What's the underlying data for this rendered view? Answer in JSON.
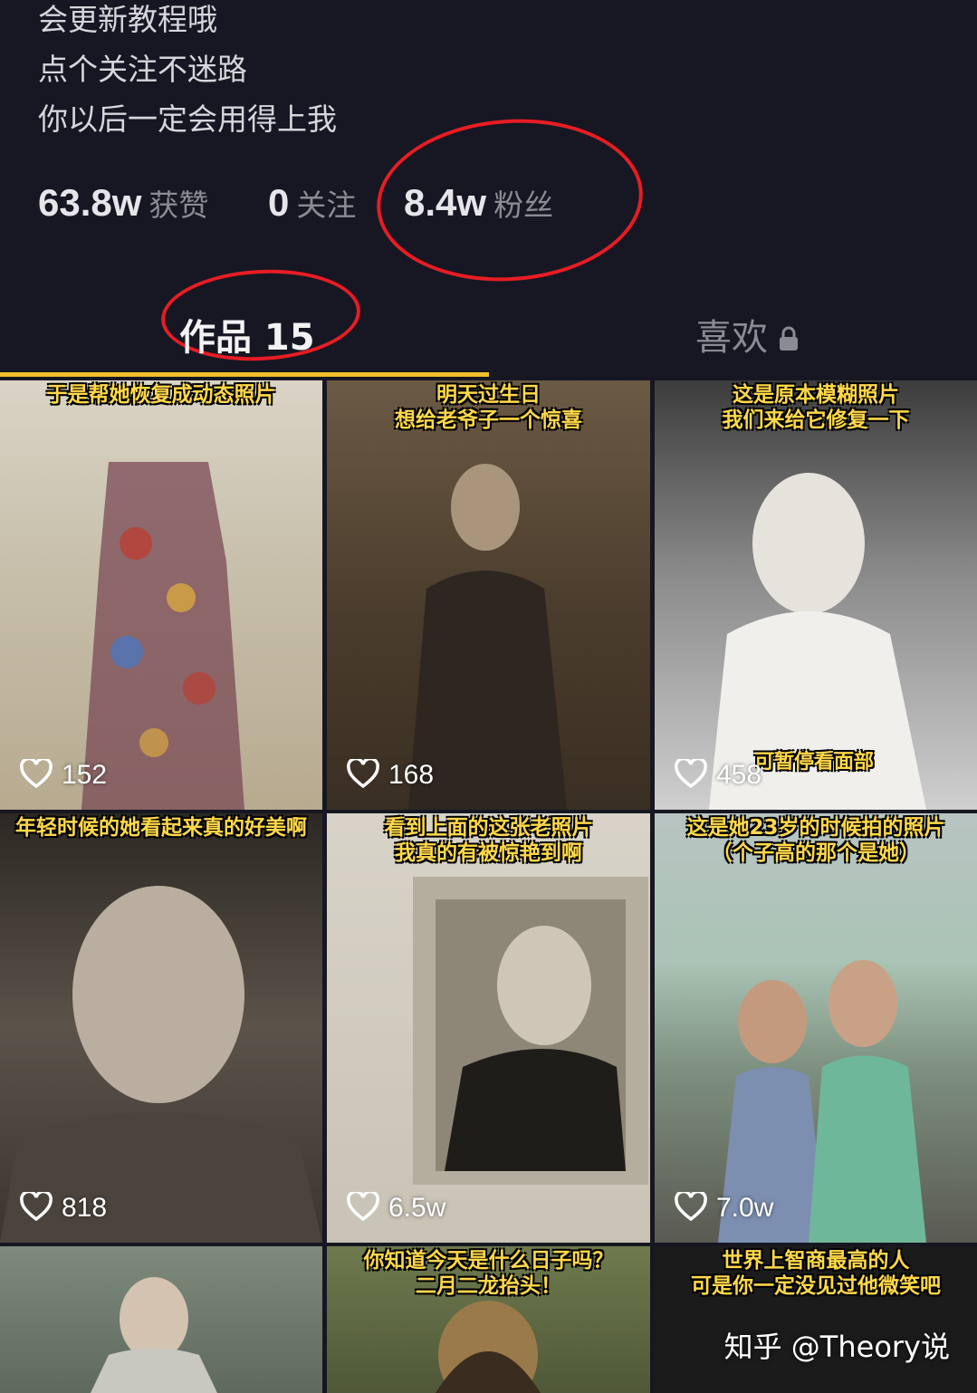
{
  "bio": {
    "lines": [
      "会更新教程哦",
      "点个关注不迷路",
      "你以后一定会用得上我"
    ]
  },
  "stats": [
    {
      "value": "63.8w",
      "label": "获赞"
    },
    {
      "value": "0",
      "label": "关注"
    },
    {
      "value": "8.4w",
      "label": "粉丝"
    }
  ],
  "tabs": {
    "works": "作品 15",
    "likes": "喜欢"
  },
  "videos": [
    {
      "caption": "于是帮她恢复成动态照片",
      "likes": "152"
    },
    {
      "caption": "明天过生日\n想给老爷子一个惊喜",
      "likes": "168"
    },
    {
      "caption": "这是原本模糊照片\n我们来给它修复一下",
      "likes": "458",
      "sub": "可暂停看面部"
    },
    {
      "caption": "年轻时候的她看起来真的好美啊",
      "likes": "818"
    },
    {
      "caption": "看到上面的这张老照片\n我真的有被惊艳到啊",
      "likes": "6.5w"
    },
    {
      "caption": "这是她23岁的时候拍的照片\n（个子高的那个是她）",
      "likes": "7.0w"
    },
    {
      "caption": "",
      "likes": ""
    },
    {
      "caption": "你知道今天是什么日子吗？\n二月二龙抬头！",
      "likes": ""
    },
    {
      "caption": "世界上智商最高的人\n可是你一定没见过他微笑吧",
      "likes": ""
    }
  ],
  "watermark": "知乎 @Theory说",
  "colors": {
    "background": "#161722",
    "accent": "#f1c12d",
    "annotation": "#e81c24",
    "caption": "#ffd84a"
  }
}
